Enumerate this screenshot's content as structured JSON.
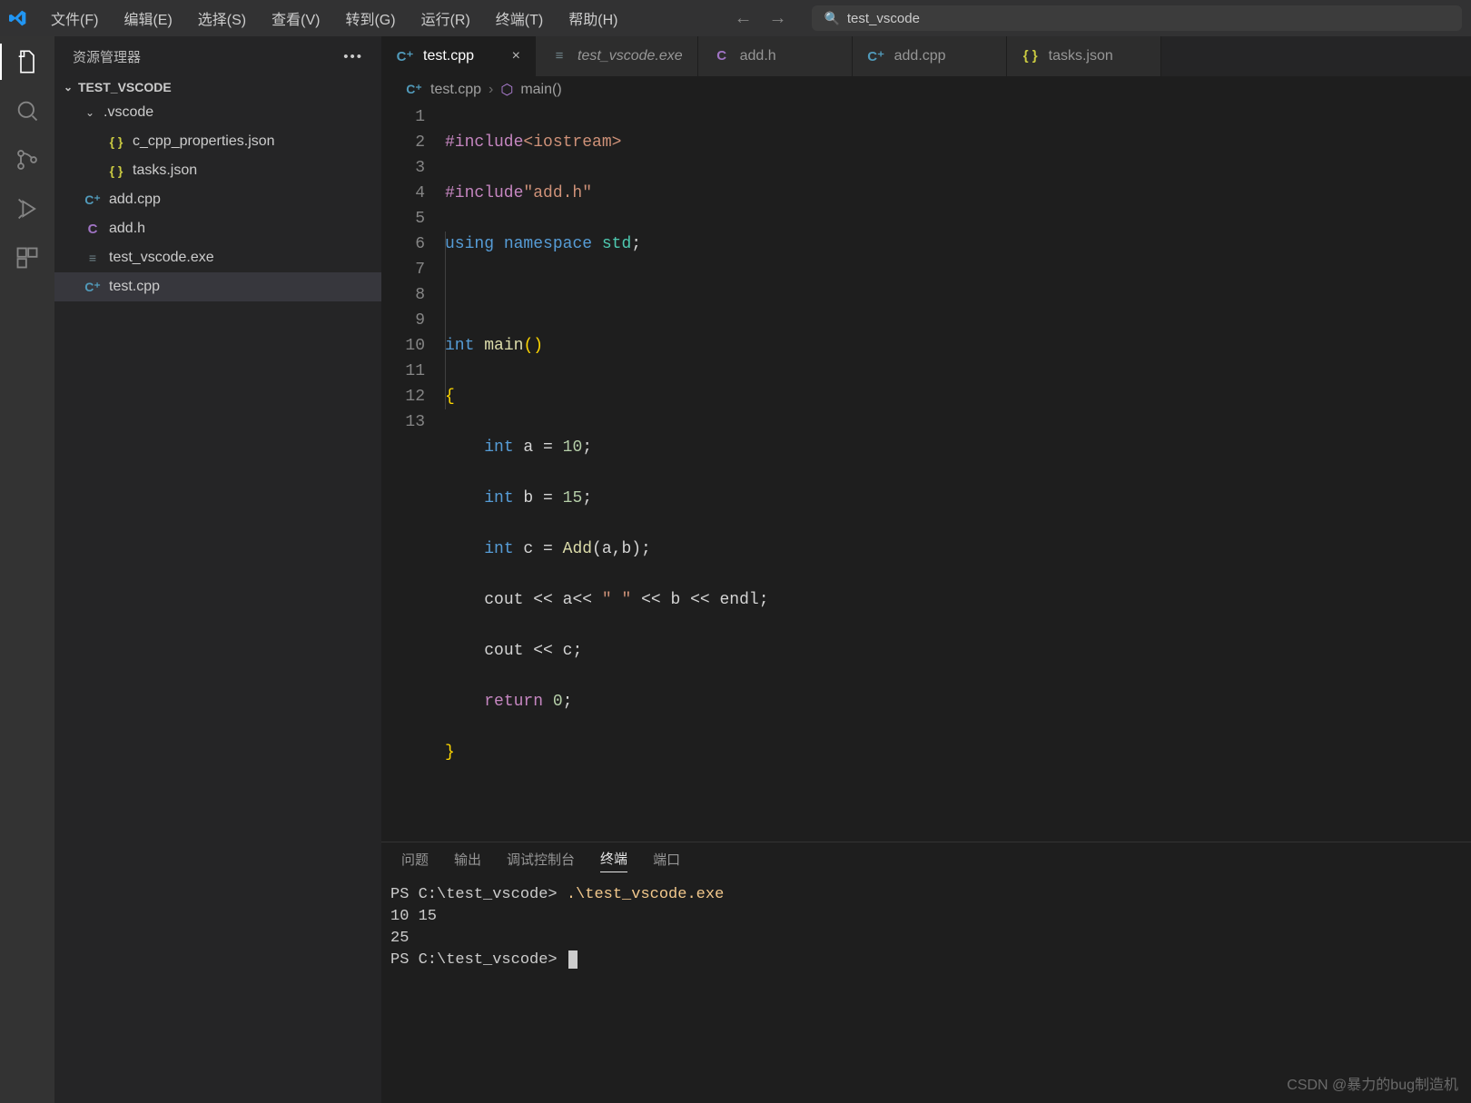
{
  "menu": {
    "items": [
      "文件(F)",
      "编辑(E)",
      "选择(S)",
      "查看(V)",
      "转到(G)",
      "运行(R)",
      "终端(T)",
      "帮助(H)"
    ]
  },
  "search": {
    "text": "test_vscode"
  },
  "sidebar": {
    "title": "资源管理器",
    "folder": "TEST_VSCODE",
    "vscode_folder": ".vscode",
    "files": {
      "props": "c_cpp_properties.json",
      "tasks": "tasks.json",
      "addcpp": "add.cpp",
      "addh": "add.h",
      "exe": "test_vscode.exe",
      "testcpp": "test.cpp"
    }
  },
  "tabs": {
    "t0": "test.cpp",
    "t1": "test_vscode.exe",
    "t2": "add.h",
    "t3": "add.cpp",
    "t4": "tasks.json"
  },
  "breadcrumb": {
    "file": "test.cpp",
    "symbol": "main()"
  },
  "code": {
    "lines": [
      "1",
      "2",
      "3",
      "4",
      "5",
      "6",
      "7",
      "8",
      "9",
      "10",
      "11",
      "12",
      "13"
    ],
    "l1a": "#include",
    "l1b": "<iostream>",
    "l2a": "#include",
    "l2b": "\"add.h\"",
    "l3a": "using",
    "l3b": "namespace",
    "l3c": "std",
    "l3d": ";",
    "l5a": "int",
    "l5b": "main",
    "l5c": "()",
    "l6": "{",
    "l7a": "int",
    "l7b": " a = ",
    "l7c": "10",
    "l7d": ";",
    "l8a": "int",
    "l8b": " b = ",
    "l8c": "15",
    "l8d": ";",
    "l9a": "int",
    "l9b": " c = ",
    "l9c": "Add",
    "l9d": "(a,b);",
    "l10a": "cout",
    "l10b": " << a<< ",
    "l10c": "\" \"",
    "l10d": " << b << ",
    "l10e": "endl",
    "l10f": ";",
    "l11a": "cout",
    "l11b": " << c;",
    "l12a": "return",
    "l12b": " ",
    "l12c": "0",
    "l12d": ";",
    "l13": "}"
  },
  "panel": {
    "tabs": {
      "p0": "问题",
      "p1": "输出",
      "p2": "调试控制台",
      "p3": "终端",
      "p4": "端口"
    },
    "prompt1": "PS C:\\test_vscode> ",
    "cmd1": ".\\test_vscode.exe",
    "out1": "10 15",
    "out2": "25",
    "prompt2": "PS C:\\test_vscode> "
  },
  "watermark": "CSDN @暴力的bug制造机"
}
